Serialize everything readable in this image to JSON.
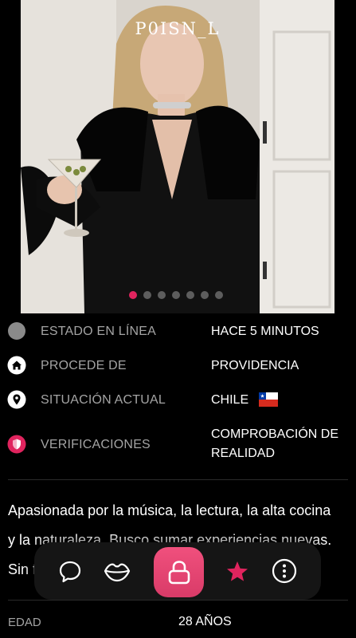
{
  "profile": {
    "username": "P0ISN_L",
    "photo_count": 7,
    "photo_active_index": 0
  },
  "info": {
    "online": {
      "label": "ESTADO EN LÍNEA",
      "value": "HACE 5 MINUTOS",
      "icon": "status-dot-icon"
    },
    "origin": {
      "label": "PROCEDE DE",
      "value": "PROVIDENCIA",
      "icon": "home-icon"
    },
    "location": {
      "label": "SITUACIÓN ACTUAL",
      "value": "CHILE",
      "icon": "location-pin-icon"
    },
    "verification": {
      "label": "VERIFICACIONES",
      "value_line1": "COMPROBACIÓN DE",
      "value_line2": "REALIDAD",
      "icon": "shield-icon"
    }
  },
  "bio": {
    "line1": "Apasionada por la música, la lectura, la alta cocina",
    "line2": "y la naturaleza. Busco sumar experiencias nuevas.",
    "line3": "Sin f"
  },
  "details": {
    "age_label": "EDAD",
    "age_value": "28 AÑOS"
  },
  "actions": [
    "chat-icon",
    "kiss-lips-icon",
    "lock-icon",
    "star-icon",
    "more-options-icon"
  ],
  "colors": {
    "accent": "#e0245e",
    "background": "#000000",
    "muted_text": "#a4a4a4"
  }
}
